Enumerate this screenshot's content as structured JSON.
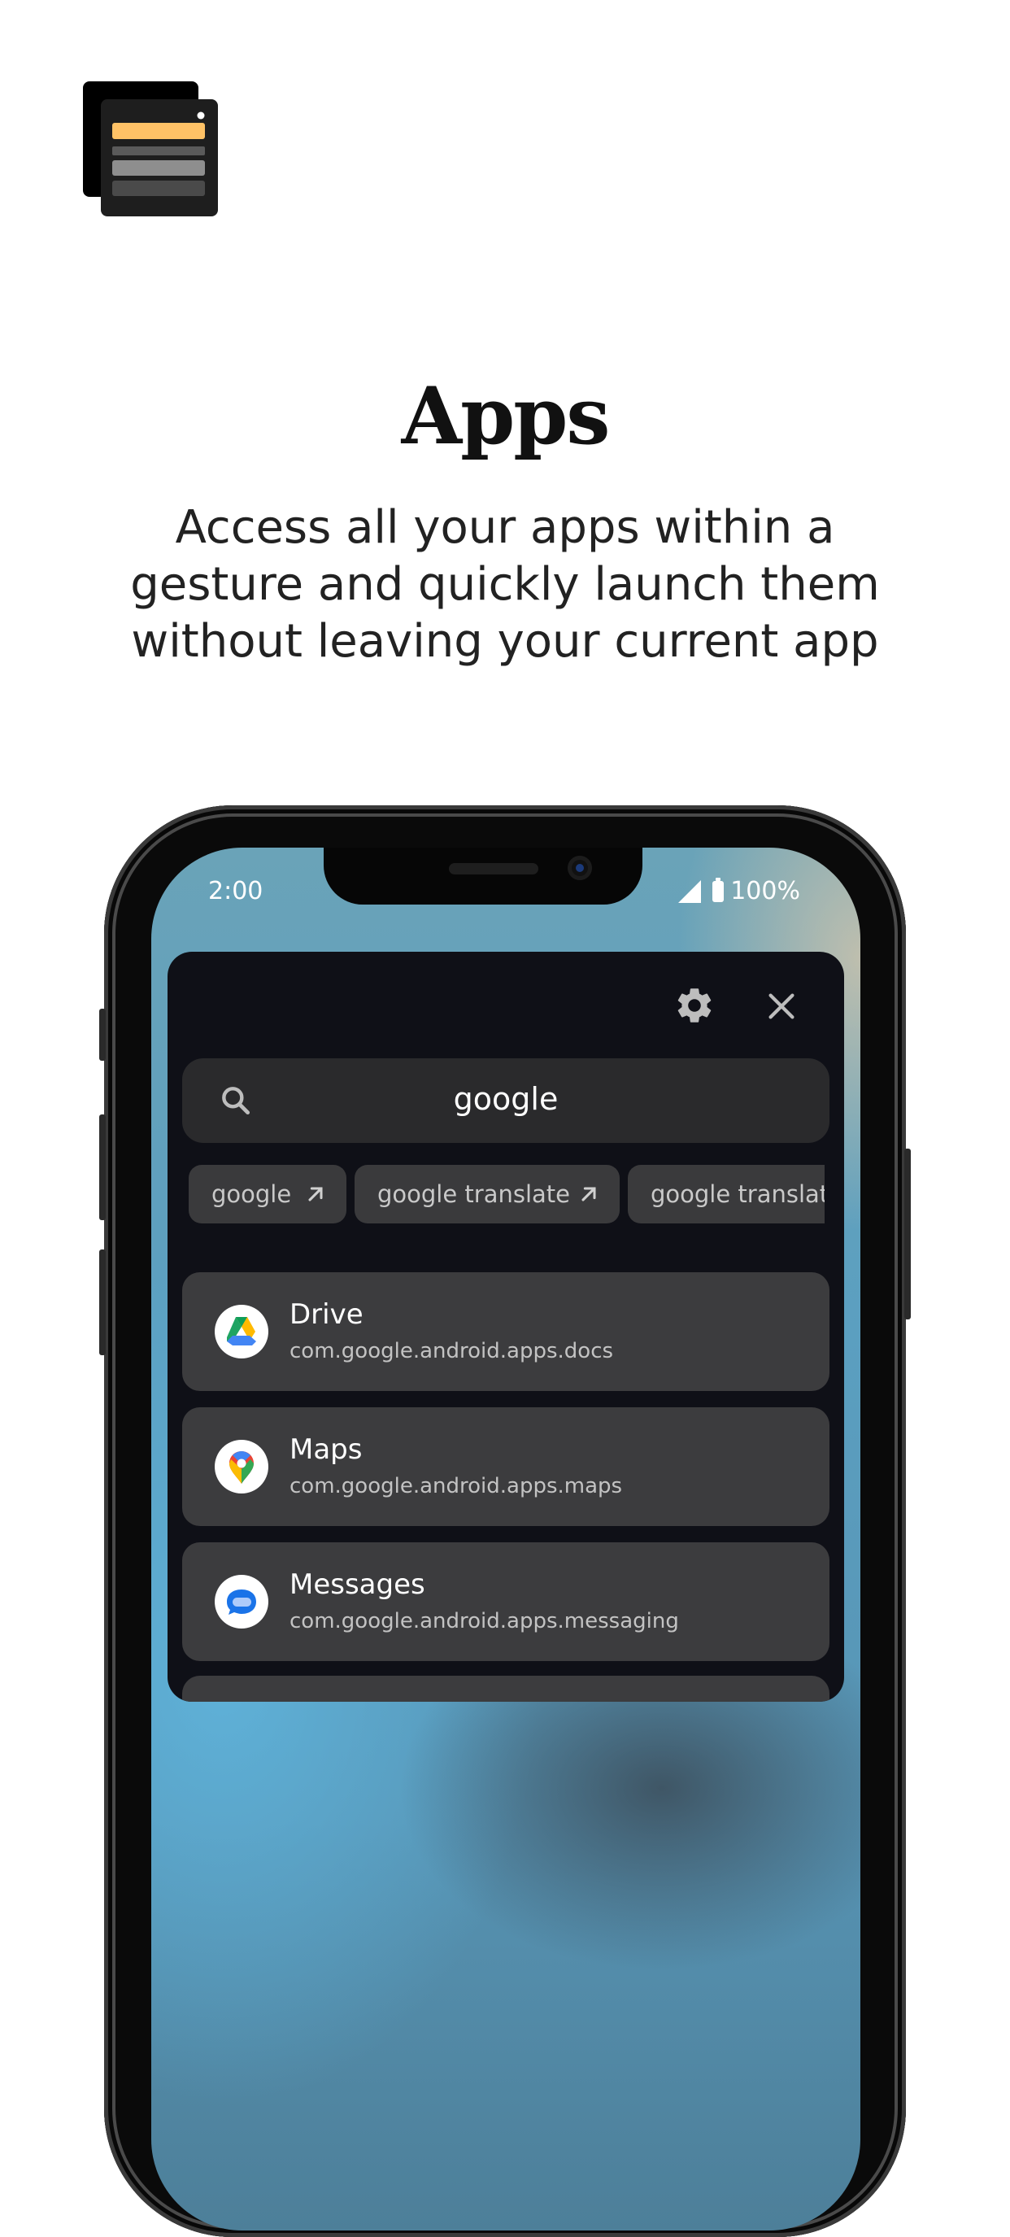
{
  "promo": {
    "title": "Apps",
    "subtitle_lines": [
      "Access all your apps within a",
      "gesture and quickly launch them",
      "without leaving your current app"
    ]
  },
  "status_bar": {
    "time": "2:00",
    "battery": "100%"
  },
  "panel": {
    "search": {
      "query": "google"
    },
    "suggestions": [
      {
        "label": "google"
      },
      {
        "label": "google translate"
      },
      {
        "label": "google translat"
      }
    ],
    "apps": [
      {
        "name": "Drive",
        "package": "com.google.android.apps.docs",
        "icon": "google-drive-icon"
      },
      {
        "name": "Maps",
        "package": "com.google.android.apps.maps",
        "icon": "google-maps-icon"
      },
      {
        "name": "Messages",
        "package": "com.google.android.apps.messaging",
        "icon": "google-messages-icon"
      }
    ]
  },
  "colors": {
    "panel_bg": "#0f1017",
    "row_bg": "#3c3c3e",
    "chip_bg": "#3a3a3c",
    "search_bg": "#2a2a2c",
    "logo_accent": "#ffc266"
  }
}
